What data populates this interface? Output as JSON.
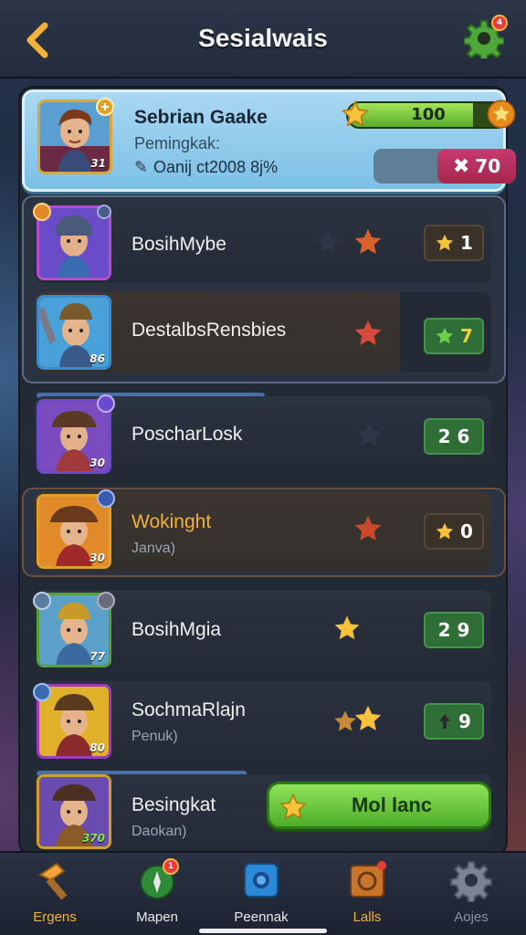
{
  "header": {
    "title": "Sesialwais"
  },
  "settings": {
    "badge": "4"
  },
  "hero": {
    "name": "Sebrian Gaake",
    "subtitle": "Pemingkak:",
    "stat": "Oanij ct2008 8j%",
    "level": "31",
    "xp_value": "100",
    "xp_fraction": 0.78,
    "energy_value": "70"
  },
  "rows": [
    {
      "name": "BosihMybe",
      "sub": "",
      "level": "",
      "score": "1",
      "chip": "dark"
    },
    {
      "name": "DestalbsRensbies",
      "sub": "",
      "level": "86",
      "score": "7",
      "chip": "green"
    },
    {
      "name": "PoscharLosk",
      "sub": "",
      "level": "30",
      "score": "2 6",
      "chip": "green"
    },
    {
      "name": "Wokinght",
      "sub": "Janva)",
      "level": "30",
      "score": "0",
      "chip": "dark"
    },
    {
      "name": "BosihMgia",
      "sub": "",
      "level": "77",
      "score": "2 9",
      "chip": "green"
    },
    {
      "name": "SochmaRlajn",
      "sub": "Penuk)",
      "level": "80",
      "score": "9",
      "chip": "green"
    },
    {
      "name": "Besingkat",
      "sub": "Daokan)",
      "level": "370",
      "score": "",
      "chip": ""
    }
  ],
  "cta": {
    "label": "Mol lanc"
  },
  "nav": [
    {
      "label": "Ergens",
      "color": "#f2b13a"
    },
    {
      "label": "Mapen",
      "color": "#e8e8e8",
      "badge": "1"
    },
    {
      "label": "Peennak",
      "color": "#e8e8e8"
    },
    {
      "label": "Lalls",
      "color": "#f2b13a"
    },
    {
      "label": "Aojes",
      "color": "#8a93a3"
    }
  ],
  "colors": {
    "accent_gold": "#f2b13a",
    "xp_green": "#58ad2a",
    "energy_pink": "#c83a6e",
    "cta_green": "#4fae2a"
  }
}
